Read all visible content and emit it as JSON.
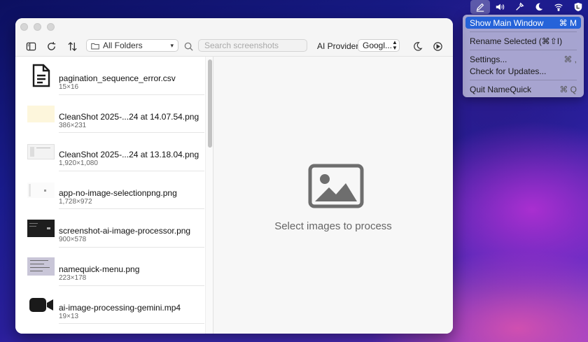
{
  "menubar": {
    "icons": [
      "namequick-pen-icon",
      "volume-icon",
      "eyedropper-icon",
      "moon-icon",
      "wifi-icon",
      "shield-icon"
    ]
  },
  "menu": {
    "items": [
      {
        "label": "Show Main Window",
        "shortcut": "⌘ M"
      },
      {
        "label": "Rename Selected (⌘⇧I)",
        "shortcut": ""
      },
      {
        "label": "Settings...",
        "shortcut": "⌘ ,"
      },
      {
        "label": "Check for Updates...",
        "shortcut": ""
      },
      {
        "label": "Quit NameQuick",
        "shortcut": "⌘ Q"
      }
    ]
  },
  "toolbar": {
    "folder_label": "All Folders",
    "search_placeholder": "Search screenshots",
    "ai_provider_label": "AI Provider",
    "provider_value": "Googl..."
  },
  "files": [
    {
      "name": "pagination_sequence_error.csv",
      "dims": "15×16",
      "icon": "document-icon"
    },
    {
      "name": "CleanShot 2025-...24 at 14.07.54.png",
      "dims": "386×231",
      "icon": "image-thumbnail"
    },
    {
      "name": "CleanShot 2025-...24 at 13.18.04.png",
      "dims": "1,920×1,080",
      "icon": "image-thumbnail"
    },
    {
      "name": "app-no-image-selectionpng.png",
      "dims": "1,728×972",
      "icon": "image-thumbnail"
    },
    {
      "name": "screenshot-ai-image-processor.png",
      "dims": "900×578",
      "icon": "image-thumbnail"
    },
    {
      "name": "namequick-menu.png",
      "dims": "223×178",
      "icon": "image-thumbnail"
    },
    {
      "name": "ai-image-processing-gemini.mp4",
      "dims": "19×13",
      "icon": "video-camera-icon"
    }
  ],
  "main": {
    "placeholder_text": "Select images to process"
  },
  "colors": {
    "menu_highlight": "#2563d9",
    "window_bg": "#ffffff",
    "pane_bg": "#f7f7f7"
  }
}
